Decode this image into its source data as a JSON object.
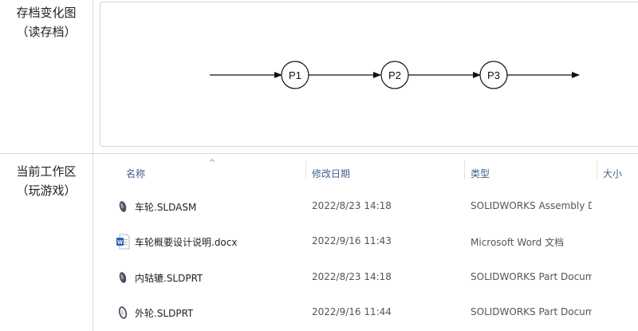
{
  "sections": {
    "archive": {
      "label_line1": "存档变化图",
      "label_line2": "（读存档）"
    },
    "workspace": {
      "label_line1": "当前工作区",
      "label_line2": "（玩游戏）"
    }
  },
  "diagram": {
    "nodes": [
      {
        "label": "P1"
      },
      {
        "label": "P2"
      },
      {
        "label": "P3"
      }
    ]
  },
  "explorer": {
    "columns": {
      "name": "名称",
      "modified": "修改日期",
      "type": "类型",
      "size": "大小"
    },
    "sort_indicator": "^",
    "files": [
      {
        "icon": "solidworks-assembly-icon",
        "name": "车轮.SLDASM",
        "modified": "2022/8/23 14:18",
        "type": "SOLIDWORKS Assembly D..."
      },
      {
        "icon": "word-document-icon",
        "name": "车轮概要设计说明.docx",
        "modified": "2022/9/16 11:43",
        "type": "Microsoft Word 文档"
      },
      {
        "icon": "solidworks-part-icon",
        "name": "内轱辘.SLDPRT",
        "modified": "2022/8/23 14:18",
        "type": "SOLIDWORKS Part Docum..."
      },
      {
        "icon": "solidworks-part-outline-icon",
        "name": "外轮.SLDPRT",
        "modified": "2022/9/16 11:44",
        "type": "SOLIDWORKS Part Docum..."
      }
    ]
  }
}
